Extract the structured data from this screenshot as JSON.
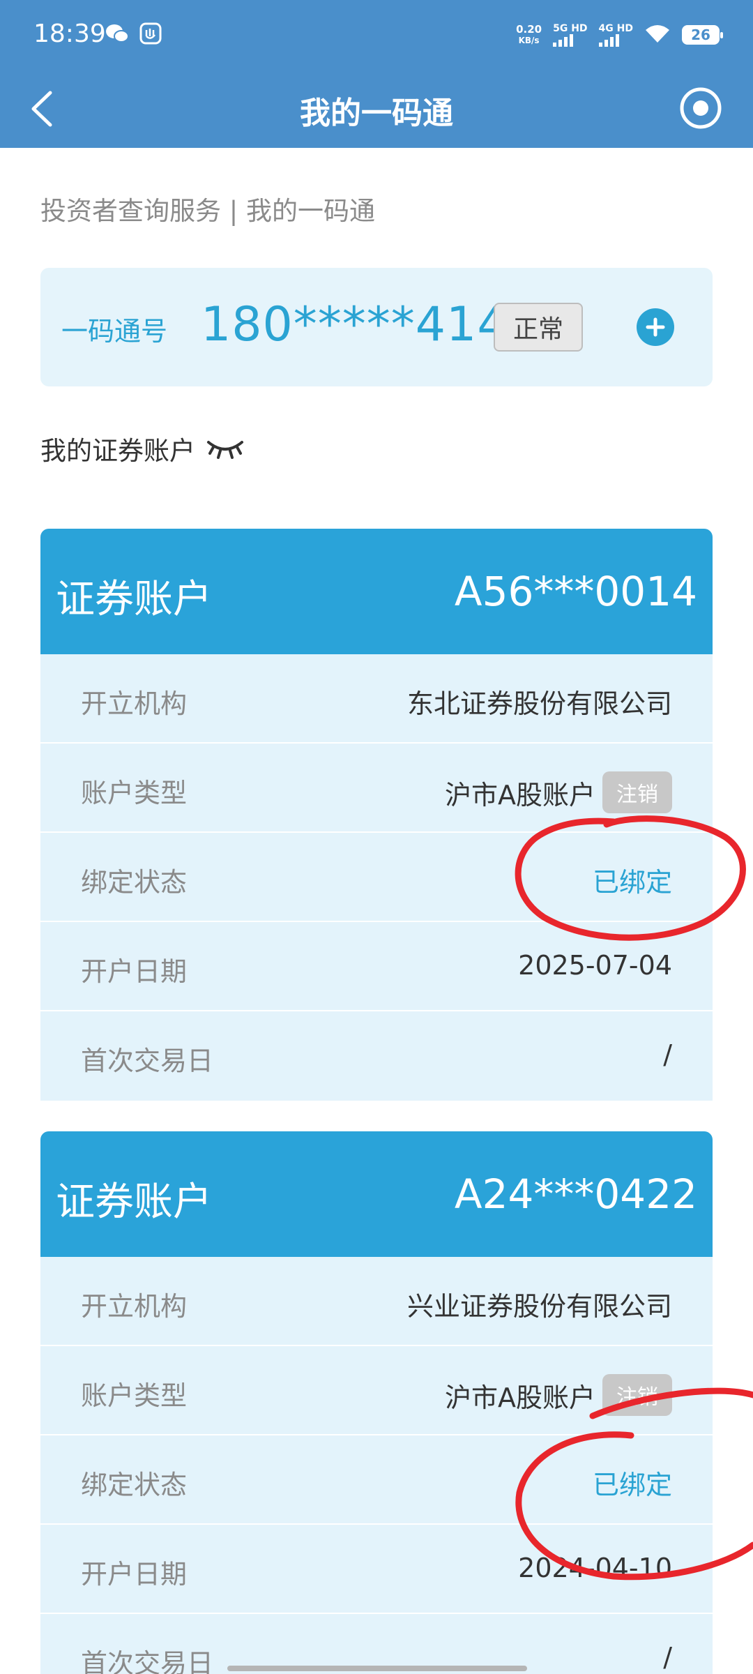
{
  "status_bar": {
    "time": "18:39",
    "net_speed_value": "0.20",
    "net_speed_unit": "KB/s",
    "sim1_label": "5G HD",
    "sim2_label": "4G HD",
    "battery": "26",
    "icons": [
      "wechat-icon",
      "app-notification-icon",
      "wifi-icon"
    ]
  },
  "navbar": {
    "title": "我的一码通",
    "back_icon": "chevron-left-icon",
    "right_icon": "target-circle-icon"
  },
  "breadcrumb": "投资者查询服务 | 我的一码通",
  "code_card": {
    "label": "一码通号",
    "number": "180*****4144",
    "status": "正常",
    "add_icon": "plus-circle-icon",
    "accent": "#2aa3d3"
  },
  "section_title": "我的证券账户",
  "section_icon": "eye-closed-icon",
  "accounts": [
    {
      "header_label": "证券账户",
      "number": "A56***0014",
      "rows": [
        {
          "label": "开立机构",
          "value": "东北证券股份有限公司"
        },
        {
          "label": "账户类型",
          "value": "沪市A股账户",
          "badge": "注销"
        },
        {
          "label": "绑定状态",
          "value": "已绑定"
        },
        {
          "label": "开户日期",
          "value": "2025-07-04"
        },
        {
          "label": "首次交易日",
          "value": "/"
        }
      ]
    },
    {
      "header_label": "证券账户",
      "number": "A24***0422",
      "rows": [
        {
          "label": "开立机构",
          "value": "兴业证券股份有限公司"
        },
        {
          "label": "账户类型",
          "value": "沪市A股账户",
          "badge": "注销"
        },
        {
          "label": "绑定状态",
          "value": "已绑定"
        },
        {
          "label": "开户日期",
          "value": "2024-04-10"
        },
        {
          "label": "首次交易日",
          "value": "/"
        }
      ]
    }
  ],
  "colors": {
    "header_bar": "#4a8fcb",
    "card_header": "#2aa3d9",
    "card_body": "#e3f3fb",
    "annotation_ink": "#e8262c"
  }
}
